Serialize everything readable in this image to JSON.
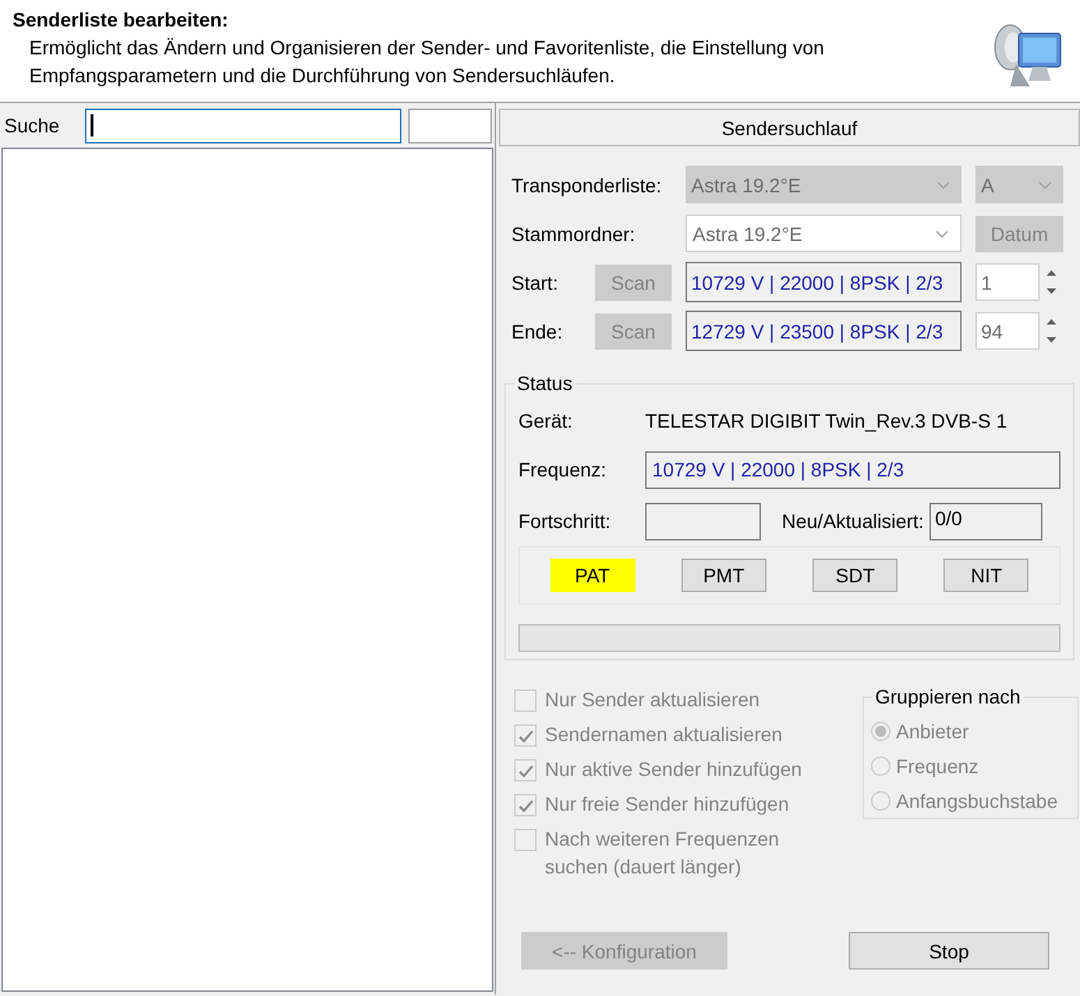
{
  "header": {
    "title": "Senderliste bearbeiten:",
    "description": "Ermöglicht das Ändern und Organisieren der Sender- und Favoritenliste, die Einstellung von Empfangsparametern und die Durchführung von Sendersuchläufen."
  },
  "search": {
    "label": "Suche"
  },
  "scan_tab": {
    "label": "Sendersuchlauf"
  },
  "transponder": {
    "label": "Transponderliste:",
    "value": "Astra 19.2°E",
    "band": "A"
  },
  "folder": {
    "label": "Stammordner:",
    "value": "Astra 19.2°E",
    "button": "Datum"
  },
  "range": [
    {
      "label": "Start:",
      "scan_button": "Scan",
      "value": "10729 V | 22000 | 8PSK | 2/3",
      "number": "1"
    },
    {
      "label": "Ende:",
      "scan_button": "Scan",
      "value": "12729 V | 23500 | 8PSK | 2/3",
      "number": "94"
    }
  ],
  "status": {
    "title": "Status",
    "device_label": "Gerät:",
    "device": "TELESTAR DIGIBIT Twin_Rev.3 DVB-S 1",
    "frequency_label": "Frequenz:",
    "frequency": "10729 V | 22000 | 8PSK | 2/3",
    "progress_label": "Fortschritt:",
    "new_label": "Neu/Aktualisiert:",
    "new_value": "0/0",
    "tables": [
      {
        "label": "PAT",
        "active": true
      },
      {
        "label": "PMT",
        "active": false
      },
      {
        "label": "SDT",
        "active": false
      },
      {
        "label": "NIT",
        "active": false
      }
    ],
    "progress": {
      "level": 0
    }
  },
  "options": [
    {
      "label": "Nur Sender aktualisieren",
      "checked": false
    },
    {
      "label": "Sendernamen aktualisieren",
      "checked": true
    },
    {
      "label": "Nur aktive Sender hinzufügen",
      "checked": true
    },
    {
      "label": "Nur freie Sender hinzufügen",
      "checked": true
    },
    {
      "label": "Nach weiteren Frequenzen suchen (dauert länger)",
      "checked": false
    }
  ],
  "group": {
    "title": "Gruppieren nach",
    "options": [
      {
        "label": "Anbieter",
        "selected": true
      },
      {
        "label": "Frequenz",
        "selected": false
      },
      {
        "label": "Anfangsbuchstabe",
        "selected": false
      }
    ]
  },
  "back_button": {
    "label": "<-- Konfiguration",
    "disabled": true
  },
  "stop_button": {
    "label": "Stop",
    "disabled": false
  }
}
